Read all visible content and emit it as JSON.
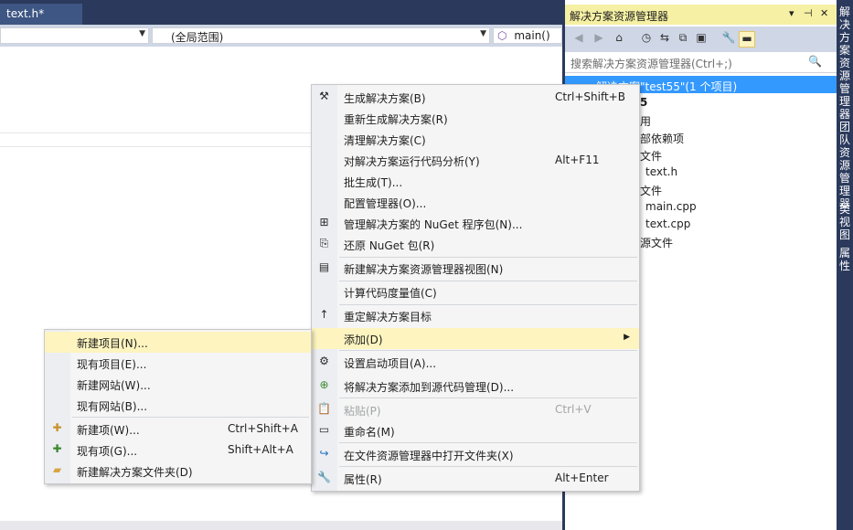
{
  "editor": {
    "tab_label": "text.h*",
    "nav_scope_value": "(全局范围)",
    "nav_func_value": "main()"
  },
  "solution_explorer": {
    "title": "解决方案资源管理器",
    "title_controls": [
      "▾",
      "⊣",
      "✕"
    ],
    "search_placeholder": "搜索解决方案资源管理器(Ctrl+;)",
    "tree": [
      {
        "text": "解决方案\"test55\"(1 个项目)",
        "selected": true
      },
      {
        "text": "5"
      },
      {
        "text": "用"
      },
      {
        "text": "部依赖项"
      },
      {
        "text": "文件"
      },
      {
        "text": "text.h"
      },
      {
        "text": "文件"
      },
      {
        "text": "main.cpp"
      },
      {
        "text": "text.cpp"
      },
      {
        "text": "源文件"
      }
    ]
  },
  "right_rail": [
    "解决方案资源管理器",
    "团队资源管理器",
    "类视图",
    "属性"
  ],
  "context_menu": {
    "items": [
      {
        "label": "生成解决方案(B)",
        "shortcut": "Ctrl+Shift+B",
        "icon": "build-icon"
      },
      {
        "label": "重新生成解决方案(R)"
      },
      {
        "label": "清理解决方案(C)"
      },
      {
        "label": "对解决方案运行代码分析(Y)",
        "shortcut": "Alt+F11"
      },
      {
        "label": "批生成(T)..."
      },
      {
        "label": "配置管理器(O)..."
      },
      {
        "label": "管理解决方案的 NuGet 程序包(N)...",
        "icon": "nuget-icon"
      },
      {
        "label": "还原 NuGet 包(R)",
        "icon": "restore-icon"
      },
      {
        "label": "新建解决方案资源管理器视图(N)",
        "icon": "new-view-icon"
      },
      {
        "label": "计算代码度量值(C)"
      },
      {
        "label": "重定解决方案目标",
        "icon": "arrow-up-icon"
      },
      {
        "label": "添加(D)",
        "submenu": true,
        "highlighted": true
      },
      {
        "label": "设置启动项目(A)...",
        "icon": "gear-icon"
      },
      {
        "label": "将解决方案添加到源代码管理(D)...",
        "icon": "source-control-icon"
      },
      {
        "label": "粘贴(P)",
        "shortcut": "Ctrl+V",
        "disabled": true,
        "icon": "paste-icon"
      },
      {
        "label": "重命名(M)",
        "icon": "rename-icon"
      },
      {
        "label": "在文件资源管理器中打开文件夹(X)",
        "icon": "open-folder-icon"
      },
      {
        "label": "属性(R)",
        "shortcut": "Alt+Enter",
        "icon": "wrench-icon"
      }
    ]
  },
  "add_submenu": {
    "items": [
      {
        "label": "新建项目(N)...",
        "highlighted": true
      },
      {
        "label": "现有项目(E)..."
      },
      {
        "label": "新建网站(W)..."
      },
      {
        "label": "现有网站(B)..."
      },
      {
        "label": "新建项(W)...",
        "shortcut": "Ctrl+Shift+A",
        "icon": "new-item-icon"
      },
      {
        "label": "现有项(G)...",
        "shortcut": "Shift+Alt+A",
        "icon": "existing-item-icon"
      },
      {
        "label": "新建解决方案文件夹(D)",
        "icon": "new-folder-icon"
      }
    ]
  }
}
